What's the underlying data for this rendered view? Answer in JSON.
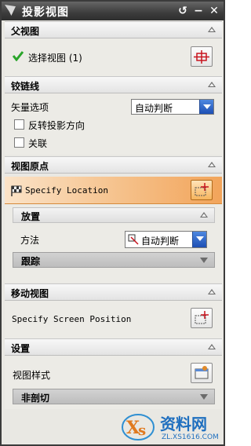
{
  "window": {
    "title": "投影视图",
    "buttons": [
      "reset",
      "minimize",
      "close"
    ]
  },
  "sections": {
    "parent_view": {
      "label": "父视图",
      "select_view_label": "选择视图 (1)"
    },
    "hinge_line": {
      "label": "铰链线",
      "vector_option_label": "矢量选项",
      "vector_option_value": "自动判断",
      "reverse_direction_label": "反转投影方向",
      "associative_label": "关联"
    },
    "view_origin": {
      "label": "视图原点",
      "specify_location_label": "Specify Location",
      "placement": {
        "label": "放置",
        "method_label": "方法",
        "method_value": "自动判断",
        "track_label": "跟踪"
      }
    },
    "move_view": {
      "label": "移动视图",
      "specify_screen_position_label": "Specify Screen Position"
    },
    "settings": {
      "label": "设置",
      "view_style_label": "视图样式",
      "section_style_label": "非剖切"
    }
  },
  "watermark": {
    "brand": "资料网",
    "url": "ZL.XS1616.COM"
  },
  "colors": {
    "title_bar": "#3c3c3c",
    "highlight_row": "#f5c089",
    "checkmark": "#2aa52a",
    "combo_arrow": "#1d4fb4"
  }
}
